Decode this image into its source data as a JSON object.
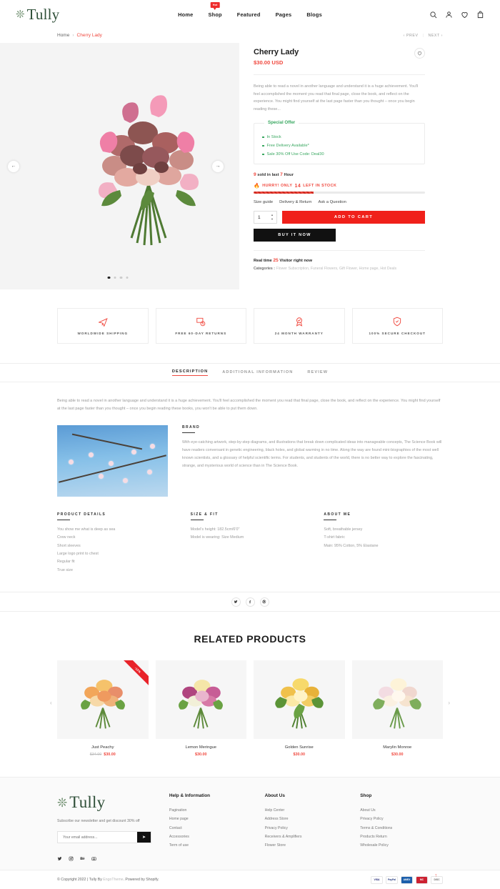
{
  "header": {
    "logo_text": "Tully",
    "logo_icon": "flower-icon",
    "nav": [
      {
        "label": "Home",
        "badge": null
      },
      {
        "label": "Shop",
        "badge": "Hot"
      },
      {
        "label": "Featured",
        "badge": null
      },
      {
        "label": "Pages",
        "badge": null
      },
      {
        "label": "Blogs",
        "badge": null
      }
    ],
    "icons": [
      "search-icon",
      "user-icon",
      "heart-icon",
      "bag-icon"
    ]
  },
  "breadcrumb": {
    "home": "Home",
    "separator": "›",
    "current": "Cherry Lady",
    "prev": "‹  PREV",
    "divider": "|",
    "next": "NEXT  ›"
  },
  "gallery": {
    "prev_arrow": "←",
    "next_arrow": "→",
    "dots": 4,
    "active_dot": 0
  },
  "product": {
    "title": "Cherry Lady",
    "price": "$30.00 USD",
    "wishlist_icon": "heart-icon",
    "description": "Being able to read a novel in another language and understand it is a huge achievement. You'll feel accomplished the moment you read that final page, close the book, and reflect on the experience. You might find yourself at the last page faster than you thought – once you begin reading these...",
    "offer": {
      "title": "Special Offer",
      "items": [
        "In Stock",
        "Free Delivery Available*",
        "Sale 30% Off Use Code: Deal30"
      ]
    },
    "sold": {
      "count": "9",
      "text_before": "",
      "text_mid": " sold in last ",
      "hours": "7",
      "text_after": " Hour"
    },
    "hurry": {
      "icon": "flame-icon",
      "prefix": "HURRY! ONLY ",
      "count": "14",
      "suffix": " LEFT IN STOCK"
    },
    "stock_percent": 35,
    "meta_links": [
      "Size guide",
      "Delivery & Return",
      "Ask a Question"
    ],
    "quantity": "1",
    "add_to_cart": "ADD TO CART",
    "buy_now": "BUY IT NOW",
    "visitor": {
      "prefix": "Real time ",
      "count": "25",
      "suffix": " Visitor right now"
    },
    "categories_label": "Categories :",
    "categories_value": "Flower Subscription, Funeral Flowers, Gift Flower, Home page, Hot Deals"
  },
  "features": [
    {
      "icon": "plane-icon",
      "label": "WORLDWIDE SHIPPING"
    },
    {
      "icon": "return-box-icon",
      "label": "FREE 60-DAY RETURNS"
    },
    {
      "icon": "warranty-badge-icon",
      "label": "24 MONTH WARRANTY"
    },
    {
      "icon": "shield-check-icon",
      "label": "100% SECURE CHECKOUT"
    }
  ],
  "tabs": [
    {
      "label": "DESCRIPTION",
      "active": true
    },
    {
      "label": "ADDITIONAL INFORMATION",
      "active": false
    },
    {
      "label": "REVIEW",
      "active": false
    }
  ],
  "description_tab": {
    "intro": "Being able to read a novel in another language and understand it is a huge achievement. You'll feel accomplished the moment you read that final page, close the book, and reflect on the experience. You might find yourself at the last page faster than you thought – once you begin reading these books, you won't be able to put them down.",
    "brand": {
      "heading": "BRAND",
      "body": "With eye-catching artwork, step-by-step diagrams, and illustrations that break down complicated ideas into manageable concepts, The Science Book will have readers conversant in genetic engineering, black holes, and global warming in no time. Along the way are found mini-biographies of the most well known scientists, and a glossary of helpful scientific terms. For students, and students of the world, there is no better way to explore the fascinating, strange, and mysterious world of science than in The Science Book."
    },
    "columns": [
      {
        "heading": "PRODUCT DETAILS",
        "items": [
          "You show me what is deep as sea",
          "Crew neck",
          "Short sleeves",
          "Large logo print to chest",
          "Regular fit",
          "True size"
        ]
      },
      {
        "heading": "SIZE & FIT",
        "items": [
          "Model's height: 182.5cm/6'0\"",
          "Model is wearing: Size Medium"
        ]
      },
      {
        "heading": "ABOUT ME",
        "items": [
          "Soft, breathable jersey",
          "T-shirt fabric",
          "Main: 95% Cotton, 5% Elastane"
        ]
      }
    ],
    "share_icons": [
      "twitter-icon",
      "facebook-icon",
      "pinterest-icon"
    ]
  },
  "related": {
    "title": "RELATED PRODUCTS",
    "prev_arrow": "‹",
    "next_arrow": "›",
    "products": [
      {
        "name": "Just Peachy",
        "price": "$30.00",
        "old_price": "$34.00",
        "badge": "-12%"
      },
      {
        "name": "Lemon Meringue",
        "price": "$30.00",
        "old_price": null,
        "badge": null
      },
      {
        "name": "Golden Sunrise",
        "price": "$30.00",
        "old_price": null,
        "badge": null
      },
      {
        "name": "Marylin Monroe",
        "price": "$30.00",
        "old_price": null,
        "badge": null
      }
    ]
  },
  "footer": {
    "logo_text": "Tully",
    "newsletter_text": "Subscribe our newsletter and get discount 30% off",
    "email_placeholder": "Your email address...",
    "send_icon": "send-icon",
    "socials": [
      "twitter-icon",
      "instagram-icon",
      "behance-icon",
      "camera-icon"
    ],
    "columns": [
      {
        "heading": "Help & Information",
        "links": [
          "Pagination",
          "Home page",
          "Contact",
          "Accessories",
          "Term of use"
        ]
      },
      {
        "heading": "About Us",
        "links": [
          "Help Center",
          "Address Store",
          "Privacy Policy",
          "Receivers & Amplifiers",
          "Flower Store"
        ]
      },
      {
        "heading": "Shop",
        "links": [
          "About Us",
          "Privacy Policy",
          "Terms & Conditions",
          "Products Return",
          "Wholesale Policy"
        ]
      }
    ],
    "copyright_main": "© Copyright 2022 | Tully By ",
    "copyright_brand": "EngoTheme",
    "copyright_tail": ". Powered by Shopify.",
    "payments": [
      {
        "name": "VISA",
        "bg": "#ffffff",
        "fg": "#1a1f71"
      },
      {
        "name": "PayPal",
        "bg": "#ffffff",
        "fg": "#253b80"
      },
      {
        "name": "AMEX",
        "bg": "#1c5fab",
        "fg": "#ffffff"
      },
      {
        "name": "MC",
        "bg": "#cc2131",
        "fg": "#ffffff"
      },
      {
        "name": "DISC",
        "bg": "#ffffff",
        "fg": "#6b6b6b"
      }
    ],
    "to_top_icon": "arrow-up-icon"
  },
  "colors": {
    "accent_red": "#f0483e",
    "cart_red": "#f0201a",
    "green": "#3aa861",
    "dark": "#111111"
  }
}
